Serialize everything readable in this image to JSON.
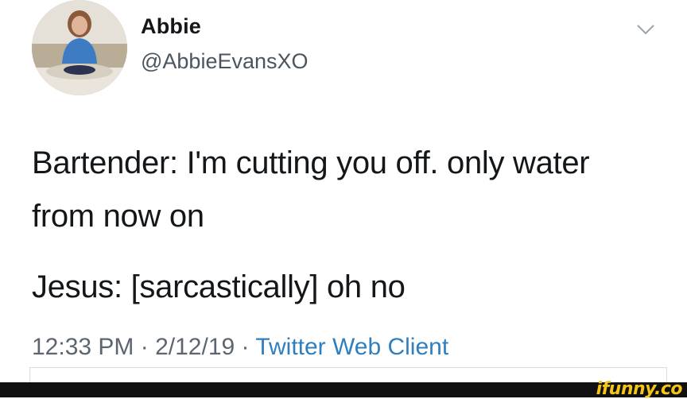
{
  "tweet": {
    "display_name": "Abbie",
    "handle": "@AbbieEvansXO",
    "text_lines": [
      "Bartender: I'm cutting you off. only water",
      "from now on",
      "Jesus: [sarcastically] oh no"
    ],
    "time": "12:33 PM",
    "separator": " · ",
    "date": "2/12/19",
    "client": "Twitter Web Client"
  },
  "icons": {
    "menu": "chevron-down-icon"
  },
  "colors": {
    "text": "#14171a",
    "meta": "#5d6670",
    "link": "#2f7fbf",
    "watermark": "#f5c518"
  },
  "watermark": {
    "text": "ifunny.co"
  }
}
